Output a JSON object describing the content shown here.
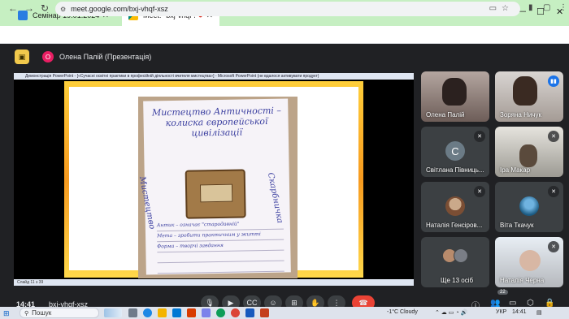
{
  "browser": {
    "tabs": [
      {
        "label": "Семінар 19.01.2024",
        "active": false,
        "color": "#2a7de1"
      },
      {
        "label": "Meet: \"bxj-vhqf-xsz\"",
        "active": true,
        "color": "#00897b"
      }
    ],
    "new_tab": "+",
    "window_controls": {
      "chevron": "⌄",
      "minimize": "—",
      "maximize": "☐",
      "close": "✕"
    },
    "url": "meet.google.com/bxj-vhqf-xsz"
  },
  "meet": {
    "presenter": {
      "initial": "О",
      "label": "Олена Палій (Презентація)"
    },
    "slide": {
      "window_title": "Демонстрація PowerPoint - [«Сучасні освітні практики в професійній діяльності вчителя мистецтва»] - Microsoft PowerPoint (не вдалося активувати продукт)",
      "poster_title": "Мистецтво Античності – колиска європейської цивілізації",
      "left_label": "Мистецтво",
      "right_label": "Скарбничка",
      "lines": [
        "Антик – означає \"стародавній\"",
        "Мета – зробити практичним у житті",
        "Форма – творчі завдання"
      ],
      "status": "Слайд 11 з 39"
    },
    "participants": [
      {
        "name": "Олена Палій",
        "status": "none"
      },
      {
        "name": "Зоряна Ничук",
        "status": "speaking"
      },
      {
        "name": "Світлана Пiвниць...",
        "status": "muted",
        "initial": "С"
      },
      {
        "name": "Іра Макар",
        "status": "muted"
      },
      {
        "name": "Наталія Генсіров...",
        "status": "muted"
      },
      {
        "name": "Віта Ткачук",
        "status": "muted"
      },
      {
        "name": "Ще 13 осіб",
        "status": "none"
      },
      {
        "name": "Наталія Черна",
        "status": "muted"
      }
    ],
    "time": "14:41",
    "meeting_code": "bxj-vhqf-xsz",
    "participants_count": "22"
  },
  "taskbar": {
    "search_placeholder": "Пошук",
    "weather": "-1°C  Cloudy",
    "language": "УКР",
    "clock": "14:41"
  },
  "colors": {
    "meet_bg": "#202124",
    "tab_strip": "#c6efc2",
    "end_call": "#ea4335",
    "slide_frame": "#f79a1f",
    "speaking": "#1a73e8"
  }
}
